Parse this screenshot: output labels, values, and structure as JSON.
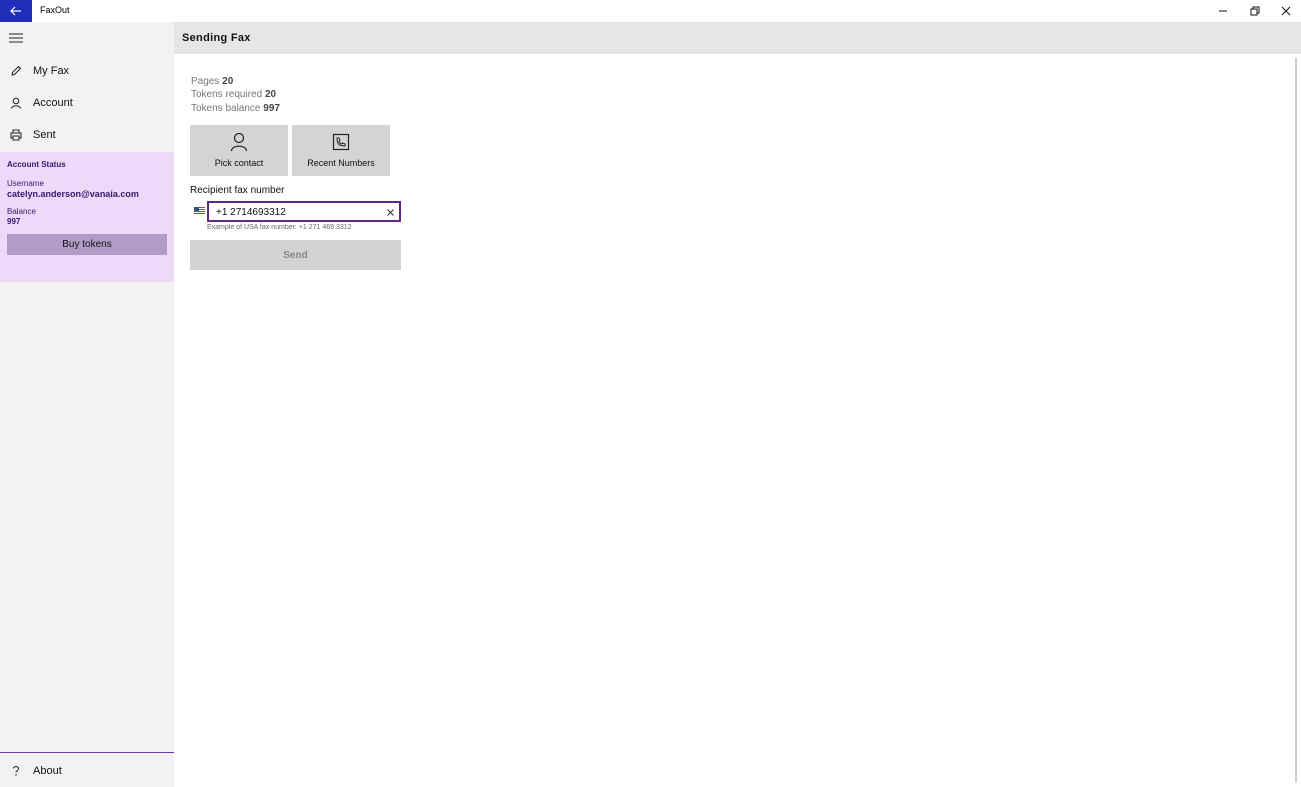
{
  "window": {
    "title": "FaxOut",
    "back_icon": "back-arrow-icon",
    "minimize_icon": "minimize-icon",
    "maximize_icon": "restore-icon",
    "close_icon": "close-icon"
  },
  "sidebar": {
    "menu_icon": "hamburger-icon",
    "items": [
      {
        "label": "My Fax",
        "icon": "pencil-icon"
      },
      {
        "label": "Account",
        "icon": "person-icon"
      },
      {
        "label": "Sent",
        "icon": "printer-icon"
      }
    ],
    "account_status": {
      "title": "Account Status",
      "username_label": "Username",
      "username": "catelyn.anderson@vanaia.com",
      "balance_label": "Balance",
      "balance": "997",
      "buy_label": "Buy tokens"
    },
    "about": {
      "label": "About",
      "icon": "question-icon"
    },
    "colors": {
      "panel_bg": "#ecdaf8",
      "panel_text": "#3a1572",
      "button_bg": "#b39bc8"
    }
  },
  "main": {
    "title": "Sending Fax",
    "stats": {
      "pages_label": "Pages",
      "pages": "20",
      "required_label": "Tokens required",
      "required": "20",
      "balance_label": "Tokens balance",
      "balance": "997"
    },
    "tiles": [
      {
        "label": "Pick contact",
        "icon": "contact-icon"
      },
      {
        "label": "Recent Numbers",
        "icon": "phone-book-icon"
      }
    ],
    "recipient_label": "Recipient fax number",
    "flag_icon": "us-flag-icon",
    "fax_number": "+1 2714693312",
    "example": "Example of USA fax number: +1 271 469 3312",
    "send_label": "Send",
    "colors": {
      "accent": "#5b2a86",
      "back_button": "#1e2eb8"
    }
  }
}
